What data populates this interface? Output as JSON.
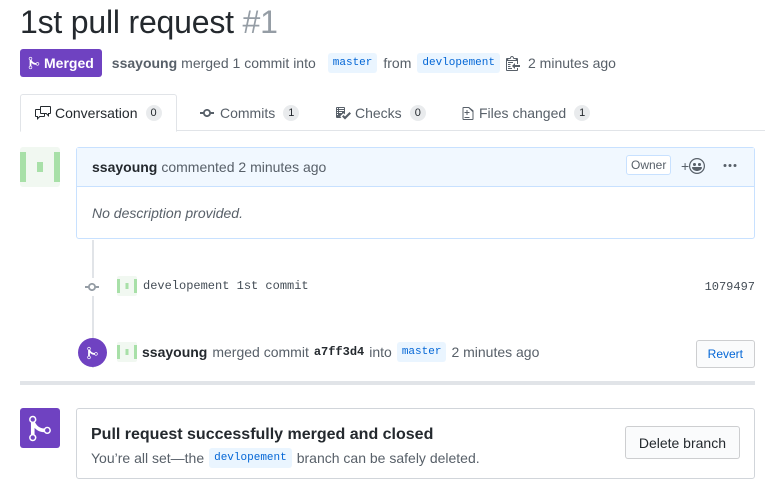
{
  "header": {
    "title": "1st pull request",
    "number": "#1"
  },
  "meta": {
    "status_label": "Merged",
    "author": "ssayoung",
    "merged_text": "merged 1 commit into",
    "base_branch": "master",
    "from_text": "from",
    "head_branch": "devlopement",
    "time": "2 minutes ago"
  },
  "tabs": [
    {
      "label": "Conversation",
      "count": "0",
      "icon": "comment-discussion-icon"
    },
    {
      "label": "Commits",
      "count": "1",
      "icon": "git-commit-icon"
    },
    {
      "label": "Checks",
      "count": "0",
      "icon": "checklist-icon"
    },
    {
      "label": "Files changed",
      "count": "1",
      "icon": "file-diff-icon"
    }
  ],
  "comment": {
    "author": "ssayoung",
    "action": "commented 2 minutes ago",
    "owner_label": "Owner",
    "reaction_label": "+",
    "body": "No description provided."
  },
  "commit": {
    "message": "developement 1st commit",
    "sha": "1079497"
  },
  "merge_event": {
    "author": "ssayoung",
    "text1": "merged commit",
    "sha": "a7ff3d4",
    "text2": "into",
    "branch": "master",
    "time": "2 minutes ago",
    "revert_label": "Revert"
  },
  "merge_message": {
    "heading": "Pull request successfully merged and closed",
    "text_before": "You’re all set—the",
    "branch": "devlopement",
    "text_after": "branch can be safely deleted.",
    "delete_label": "Delete branch"
  },
  "colors": {
    "merged_purple": "#6f42c1",
    "link_blue": "#0366d6",
    "comment_header_bg": "#f1f8ff"
  }
}
